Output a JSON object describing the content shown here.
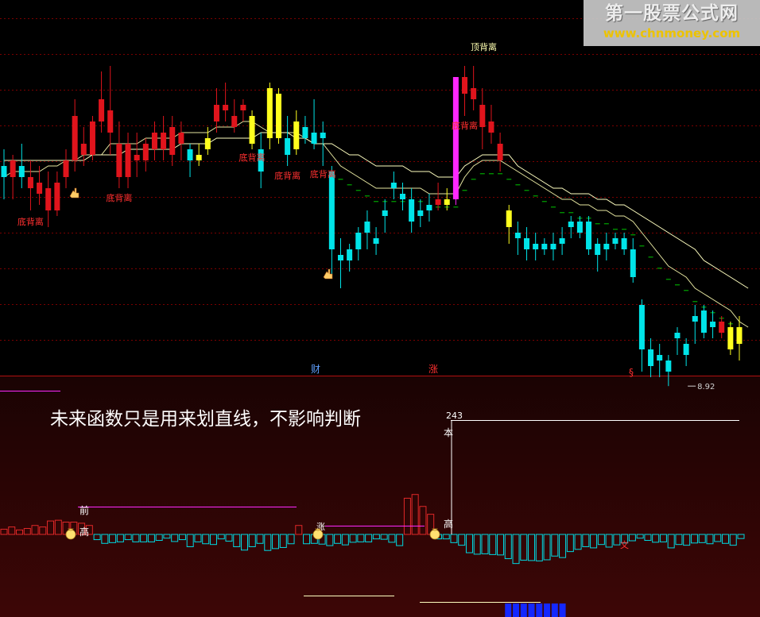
{
  "watermark": {
    "title": "第一股票公式网",
    "url": "www.chnmoney.com"
  },
  "colors": {
    "up": "#e0141c",
    "down": "#00e4e8",
    "yellow": "#ffff1e",
    "magenta": "#ff28ff",
    "label_red": "#ff3030",
    "white": "#ffffff",
    "grid": "#7a0000"
  },
  "main_panel": {
    "labels": {
      "top_divergence": "顶背离",
      "bottom_divergence": "底背离",
      "low_value": "8.92",
      "marker_cai": "财",
      "marker_zhang": "涨",
      "marker_s": "§"
    }
  },
  "sub_panel": {
    "annotation": "未来函数只是用来划直线，不影响判断",
    "peak_value": "243",
    "labels": {
      "ben": "本",
      "gao": "高",
      "qian": "前",
      "shang": "涨",
      "wen": "文"
    },
    "icon": "money-bag-icon"
  },
  "chart_data": [
    {
      "type": "candlestick",
      "title": "",
      "series": [
        {
          "name": "",
          "values": [
            {
              "o": 10.9,
              "h": 11.05,
              "l": 10.6,
              "c": 10.8,
              "cl": "down"
            },
            {
              "o": 10.8,
              "h": 11.0,
              "l": 10.6,
              "c": 10.95,
              "cl": "up"
            },
            {
              "o": 10.9,
              "h": 11.1,
              "l": 10.7,
              "c": 10.8,
              "cl": "down"
            },
            {
              "o": 10.8,
              "h": 10.95,
              "l": 10.5,
              "c": 10.7,
              "cl": "up"
            },
            {
              "o": 10.75,
              "h": 10.9,
              "l": 10.55,
              "c": 10.65,
              "cl": "up"
            },
            {
              "o": 10.7,
              "h": 10.85,
              "l": 10.35,
              "c": 10.5,
              "cl": "up"
            },
            {
              "o": 10.5,
              "h": 10.85,
              "l": 10.45,
              "c": 10.75,
              "cl": "up"
            },
            {
              "o": 10.8,
              "h": 11.05,
              "l": 10.7,
              "c": 10.95,
              "cl": "up"
            },
            {
              "o": 10.95,
              "h": 11.5,
              "l": 10.85,
              "c": 11.35,
              "cl": "up"
            },
            {
              "o": 11.1,
              "h": 11.25,
              "l": 10.9,
              "c": 11.0,
              "cl": "up"
            },
            {
              "o": 11.0,
              "h": 11.35,
              "l": 10.95,
              "c": 11.3,
              "cl": "up"
            },
            {
              "o": 11.3,
              "h": 11.75,
              "l": 11.2,
              "c": 11.5,
              "cl": "up"
            },
            {
              "o": 11.4,
              "h": 11.8,
              "l": 11.0,
              "c": 11.2,
              "cl": "up"
            },
            {
              "o": 11.1,
              "h": 11.3,
              "l": 10.7,
              "c": 10.8,
              "cl": "up"
            },
            {
              "o": 10.8,
              "h": 11.2,
              "l": 10.7,
              "c": 11.1,
              "cl": "up"
            },
            {
              "o": 11.0,
              "h": 11.2,
              "l": 10.8,
              "c": 10.95,
              "cl": "up"
            },
            {
              "o": 10.95,
              "h": 11.15,
              "l": 10.85,
              "c": 11.1,
              "cl": "up"
            },
            {
              "o": 11.05,
              "h": 11.3,
              "l": 10.95,
              "c": 11.2,
              "cl": "up"
            },
            {
              "o": 11.2,
              "h": 11.35,
              "l": 10.95,
              "c": 11.05,
              "cl": "up"
            },
            {
              "o": 11.0,
              "h": 11.35,
              "l": 10.9,
              "c": 11.25,
              "cl": "up"
            },
            {
              "o": 11.2,
              "h": 11.3,
              "l": 10.95,
              "c": 11.1,
              "cl": "up"
            },
            {
              "o": 11.05,
              "h": 11.1,
              "l": 10.8,
              "c": 10.95,
              "cl": "down"
            },
            {
              "o": 11.0,
              "h": 11.1,
              "l": 10.9,
              "c": 10.95,
              "cl": "yellow"
            },
            {
              "o": 11.05,
              "h": 11.25,
              "l": 11.0,
              "c": 11.15,
              "cl": "yellow"
            },
            {
              "o": 11.3,
              "h": 11.6,
              "l": 11.2,
              "c": 11.45,
              "cl": "up"
            },
            {
              "o": 11.45,
              "h": 11.65,
              "l": 11.3,
              "c": 11.4,
              "cl": "up"
            },
            {
              "o": 11.35,
              "h": 11.5,
              "l": 11.2,
              "c": 11.25,
              "cl": "up"
            },
            {
              "o": 11.4,
              "h": 11.5,
              "l": 11.3,
              "c": 11.45,
              "cl": "up"
            },
            {
              "o": 11.35,
              "h": 11.4,
              "l": 11.05,
              "c": 11.1,
              "cl": "yellow"
            },
            {
              "o": 11.05,
              "h": 11.2,
              "l": 10.7,
              "c": 10.85,
              "cl": "down"
            },
            {
              "o": 11.6,
              "h": 11.65,
              "l": 11.05,
              "c": 11.15,
              "cl": "yellow"
            },
            {
              "o": 11.55,
              "h": 11.6,
              "l": 11.1,
              "c": 11.15,
              "cl": "yellow"
            },
            {
              "o": 11.15,
              "h": 11.35,
              "l": 10.9,
              "c": 11.0,
              "cl": "down"
            },
            {
              "o": 11.3,
              "h": 11.4,
              "l": 11.0,
              "c": 11.05,
              "cl": "yellow"
            },
            {
              "o": 11.25,
              "h": 11.35,
              "l": 11.1,
              "c": 11.15,
              "cl": "down"
            },
            {
              "o": 11.2,
              "h": 11.5,
              "l": 11.05,
              "c": 11.1,
              "cl": "down"
            },
            {
              "o": 11.2,
              "h": 11.3,
              "l": 10.9,
              "c": 11.15,
              "cl": "down"
            },
            {
              "o": 10.85,
              "h": 10.9,
              "l": 9.9,
              "c": 10.15,
              "cl": "down"
            },
            {
              "o": 10.1,
              "h": 10.25,
              "l": 9.8,
              "c": 10.05,
              "cl": "down"
            },
            {
              "o": 10.05,
              "h": 10.2,
              "l": 9.95,
              "c": 10.15,
              "cl": "down"
            },
            {
              "o": 10.15,
              "h": 10.35,
              "l": 10.05,
              "c": 10.3,
              "cl": "down"
            },
            {
              "o": 10.3,
              "h": 10.5,
              "l": 10.15,
              "c": 10.4,
              "cl": "down"
            },
            {
              "o": 10.2,
              "h": 10.35,
              "l": 10.1,
              "c": 10.25,
              "cl": "down"
            },
            {
              "o": 10.45,
              "h": 10.6,
              "l": 10.3,
              "c": 10.5,
              "cl": "down"
            },
            {
              "o": 10.75,
              "h": 10.85,
              "l": 10.6,
              "c": 10.7,
              "cl": "down"
            },
            {
              "o": 10.65,
              "h": 10.75,
              "l": 10.5,
              "c": 10.6,
              "cl": "down"
            },
            {
              "o": 10.6,
              "h": 10.7,
              "l": 10.3,
              "c": 10.4,
              "cl": "down"
            },
            {
              "o": 10.5,
              "h": 10.6,
              "l": 10.35,
              "c": 10.45,
              "cl": "down"
            },
            {
              "o": 10.5,
              "h": 10.65,
              "l": 10.4,
              "c": 10.55,
              "cl": "down"
            },
            {
              "o": 10.55,
              "h": 10.75,
              "l": 10.5,
              "c": 10.6,
              "cl": "up"
            },
            {
              "o": 10.55,
              "h": 10.7,
              "l": 10.5,
              "c": 10.6,
              "cl": "yellow"
            },
            {
              "o": 10.6,
              "h": 11.7,
              "l": 10.55,
              "c": 11.7,
              "cl": "magenta"
            },
            {
              "o": 11.7,
              "h": 11.8,
              "l": 11.35,
              "c": 11.55,
              "cl": "up"
            },
            {
              "o": 11.6,
              "h": 11.8,
              "l": 11.4,
              "c": 11.5,
              "cl": "up"
            },
            {
              "o": 11.45,
              "h": 11.6,
              "l": 11.05,
              "c": 11.25,
              "cl": "up"
            },
            {
              "o": 11.3,
              "h": 11.45,
              "l": 11.1,
              "c": 11.2,
              "cl": "up"
            },
            {
              "o": 11.1,
              "h": 11.2,
              "l": 10.85,
              "c": 10.95,
              "cl": "up"
            },
            {
              "o": 10.5,
              "h": 10.55,
              "l": 10.2,
              "c": 10.35,
              "cl": "yellow"
            },
            {
              "o": 10.3,
              "h": 10.4,
              "l": 10.1,
              "c": 10.25,
              "cl": "down"
            },
            {
              "o": 10.25,
              "h": 10.35,
              "l": 10.05,
              "c": 10.15,
              "cl": "down"
            },
            {
              "o": 10.15,
              "h": 10.3,
              "l": 10.05,
              "c": 10.2,
              "cl": "down"
            },
            {
              "o": 10.2,
              "h": 10.25,
              "l": 10.1,
              "c": 10.15,
              "cl": "down"
            },
            {
              "o": 10.15,
              "h": 10.3,
              "l": 10.05,
              "c": 10.2,
              "cl": "down"
            },
            {
              "o": 10.2,
              "h": 10.35,
              "l": 10.1,
              "c": 10.25,
              "cl": "down"
            },
            {
              "o": 10.35,
              "h": 10.45,
              "l": 10.25,
              "c": 10.4,
              "cl": "down"
            },
            {
              "o": 10.4,
              "h": 10.45,
              "l": 10.25,
              "c": 10.3,
              "cl": "down"
            },
            {
              "o": 10.4,
              "h": 10.45,
              "l": 10.1,
              "c": 10.15,
              "cl": "down"
            },
            {
              "o": 10.2,
              "h": 10.25,
              "l": 9.95,
              "c": 10.1,
              "cl": "down"
            },
            {
              "o": 10.15,
              "h": 10.3,
              "l": 10.05,
              "c": 10.2,
              "cl": "down"
            },
            {
              "o": 10.25,
              "h": 10.3,
              "l": 10.15,
              "c": 10.2,
              "cl": "down"
            },
            {
              "o": 10.25,
              "h": 10.3,
              "l": 10.1,
              "c": 10.15,
              "cl": "down"
            },
            {
              "o": 10.15,
              "h": 10.25,
              "l": 9.85,
              "c": 9.9,
              "cl": "down"
            },
            {
              "o": 9.65,
              "h": 9.7,
              "l": 9.05,
              "c": 9.25,
              "cl": "down"
            },
            {
              "o": 9.25,
              "h": 9.35,
              "l": 9.0,
              "c": 9.1,
              "cl": "down"
            },
            {
              "o": 9.15,
              "h": 9.3,
              "l": 9.0,
              "c": 9.2,
              "cl": "down"
            },
            {
              "o": 9.15,
              "h": 9.2,
              "l": 8.92,
              "c": 9.05,
              "cl": "down"
            },
            {
              "o": 9.35,
              "h": 9.45,
              "l": 9.2,
              "c": 9.4,
              "cl": "down"
            },
            {
              "o": 9.2,
              "h": 9.35,
              "l": 9.1,
              "c": 9.3,
              "cl": "down"
            },
            {
              "o": 9.5,
              "h": 9.65,
              "l": 9.3,
              "c": 9.55,
              "cl": "down"
            },
            {
              "o": 9.6,
              "h": 9.65,
              "l": 9.35,
              "c": 9.4,
              "cl": "down"
            },
            {
              "o": 9.45,
              "h": 9.6,
              "l": 9.35,
              "c": 9.5,
              "cl": "down"
            },
            {
              "o": 9.5,
              "h": 9.55,
              "l": 9.35,
              "c": 9.4,
              "cl": "up"
            },
            {
              "o": 9.45,
              "h": 9.5,
              "l": 9.2,
              "c": 9.25,
              "cl": "yellow"
            },
            {
              "o": 9.45,
              "h": 9.55,
              "l": 9.15,
              "c": 9.3,
              "cl": "yellow"
            }
          ]
        }
      ],
      "moving_averages": [
        {
          "name": "",
          "color": "#e6e6a0",
          "values": [
            10.8,
            10.85,
            10.85,
            10.85,
            10.85,
            10.9,
            10.9,
            10.95,
            10.95,
            11.0,
            11.0,
            11.0,
            11.1,
            11.1,
            11.1,
            11.1,
            11.15,
            11.15,
            11.15,
            11.15,
            11.2,
            11.2,
            11.2,
            11.2,
            11.25,
            11.25,
            11.25,
            11.3,
            11.3,
            11.25,
            11.2,
            11.2,
            11.2,
            11.2,
            11.15,
            11.1,
            11.1,
            11.0,
            10.9,
            10.85,
            10.8,
            10.75,
            10.7,
            10.7,
            10.7,
            10.7,
            10.7,
            10.7,
            10.65,
            10.65,
            10.65,
            10.65,
            10.8,
            10.9,
            10.95,
            10.95,
            10.95,
            10.9,
            10.85,
            10.8,
            10.75,
            10.7,
            10.65,
            10.6,
            10.6,
            10.55,
            10.55,
            10.5,
            10.5,
            10.45,
            10.45,
            10.4,
            10.3,
            10.2,
            10.1,
            10.0,
            9.95,
            9.9,
            9.8,
            9.75,
            9.7,
            9.65,
            9.6,
            9.5,
            9.45
          ]
        },
        {
          "name": "",
          "color": "#ffffc0",
          "values": [
            10.95,
            10.95,
            10.95,
            10.95,
            10.95,
            10.95,
            10.95,
            10.95,
            10.95,
            10.95,
            11.0,
            11.0,
            11.0,
            11.0,
            11.05,
            11.05,
            11.05,
            11.05,
            11.05,
            11.05,
            11.1,
            11.1,
            11.1,
            11.1,
            11.15,
            11.15,
            11.15,
            11.15,
            11.15,
            11.2,
            11.2,
            11.2,
            11.2,
            11.15,
            11.15,
            11.1,
            11.1,
            11.1,
            11.05,
            11.0,
            11.0,
            10.95,
            10.9,
            10.9,
            10.9,
            10.9,
            10.85,
            10.85,
            10.85,
            10.8,
            10.8,
            10.8,
            10.9,
            10.95,
            11.0,
            11.0,
            11.0,
            11.0,
            10.9,
            10.85,
            10.8,
            10.75,
            10.7,
            10.7,
            10.65,
            10.65,
            10.65,
            10.6,
            10.6,
            10.55,
            10.55,
            10.5,
            10.45,
            10.4,
            10.35,
            10.3,
            10.25,
            10.2,
            10.15,
            10.05,
            10.0,
            9.95,
            9.9,
            9.85,
            9.8
          ]
        }
      ]
    },
    {
      "type": "bar",
      "title": "",
      "series": [
        {
          "name": "",
          "values": [
            14,
            20,
            12,
            16,
            24,
            20,
            36,
            38,
            33,
            33,
            30,
            24,
            -14,
            -24,
            -22,
            -20,
            -14,
            -20,
            -20,
            -20,
            -16,
            -10,
            -19,
            -14,
            -33,
            -20,
            -25,
            -27,
            -12,
            -18,
            -33,
            -42,
            -33,
            -24,
            -43,
            -38,
            -35,
            -25,
            24,
            -25,
            -24,
            -26,
            -30,
            -24,
            -28,
            -21,
            -20,
            -20,
            -12,
            -13,
            -21,
            -30,
            97,
            107,
            75,
            54,
            -12,
            -12,
            -22,
            -29,
            -49,
            -53,
            -52,
            -54,
            -55,
            -65,
            -78,
            -69,
            -70,
            -71,
            -68,
            -58,
            -62,
            -46,
            -40,
            -33,
            -36,
            -27,
            -34,
            -28,
            -23,
            -17,
            -10,
            -16,
            -21,
            -20,
            -36,
            -27,
            -29,
            -23,
            -22,
            -25,
            -19,
            -24,
            -29,
            -11
          ]
        }
      ],
      "ylim": [
        -90,
        260
      ]
    }
  ]
}
